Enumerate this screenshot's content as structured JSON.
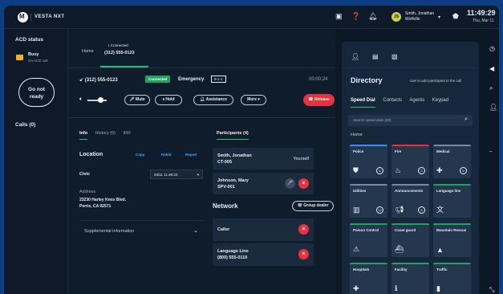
{
  "topbar": {
    "app_name": "VESTA NXT",
    "user_name": "Smith, Jonathan",
    "user_org": "Wolfville",
    "time": "11:49:29",
    "date": "Thu, Mar 11"
  },
  "acd": {
    "title": "ACD status",
    "status": "Busy",
    "status_sub": "On ACD call",
    "not_ready_line1": "Go not",
    "not_ready_line2": "ready",
    "calls_label": "Calls (0)"
  },
  "call": {
    "home_tab": "Home",
    "tab_status": "Connected",
    "tab_number": "(312) 555-0123",
    "number": "(312) 555-0123",
    "status_badge": "Connected",
    "type": "Emergency",
    "badge_911": "9-1-1",
    "timer": "00:00:24",
    "buttons": {
      "mute": "Mute",
      "hold": "Hold",
      "assistance": "Assistance",
      "more": "More",
      "release": "Release"
    }
  },
  "info": {
    "tabs": [
      "Info",
      "History (6)",
      "IRR"
    ],
    "location_title": "Location",
    "links": [
      "Copy",
      "Rebid",
      "Report"
    ],
    "civic_label": "Civic",
    "civic_value": "03/11 11:49:23",
    "address_label": "Address",
    "address_line1": "23230 Harley Knox Blvd.",
    "address_line2": "Perris, CA 92571",
    "supplemental": "Supplemental information"
  },
  "participants": {
    "title": "Participants (4)",
    "items": [
      {
        "name": "Smith, Jonathan",
        "sub": "CT-005",
        "tag": "Yourself"
      },
      {
        "name": "Johnson, Mary",
        "sub": "SPV-001"
      }
    ],
    "network_title": "Network",
    "group_button": "Group dealer",
    "network_items": [
      {
        "name": "Caller",
        "sub": ""
      },
      {
        "name": "Language Line",
        "sub": "(800) 555-0110"
      }
    ]
  },
  "directory": {
    "title": "Directory",
    "hint": "Use to add participant to the call",
    "tabs": [
      "Speed Dial",
      "Contacts",
      "Agents",
      "Keypad"
    ],
    "search_placeholder": "Search speed dials (20)",
    "home_label": "Home",
    "tiles": [
      {
        "label": "Police",
        "icon": "shield-icon",
        "count": "6",
        "color": "#3d8ef0"
      },
      {
        "label": "Fire",
        "icon": "flame-icon",
        "count": "6",
        "color": "#e5323e"
      },
      {
        "label": "Medical",
        "icon": "cross-icon",
        "count": "6",
        "color": "#7a8aa0"
      },
      {
        "label": "Utilities",
        "icon": "building-icon",
        "count": "12",
        "color": "#7a8aa0"
      },
      {
        "label": "Announcements",
        "icon": "megaphone-icon",
        "count": "6",
        "color": "#7a8aa0"
      },
      {
        "label": "Language line",
        "icon": "translate-icon",
        "count": "",
        "color": "#22a160"
      },
      {
        "label": "Poison Control",
        "icon": "warning-icon",
        "count": "",
        "color": "#22a160"
      },
      {
        "label": "Coast guard",
        "icon": "ship-icon",
        "count": "",
        "color": "#22a160"
      },
      {
        "label": "Mountain Rescue",
        "icon": "mountain-icon",
        "count": "",
        "color": "#22a160"
      },
      {
        "label": "Hospitals",
        "icon": "cross-icon",
        "count": "",
        "color": "#22a160"
      },
      {
        "label": "Facility",
        "icon": "info-icon",
        "count": "",
        "color": "#22a160"
      },
      {
        "label": "Traffic",
        "icon": "traffic-icon",
        "count": "",
        "color": "#22a160"
      }
    ]
  }
}
